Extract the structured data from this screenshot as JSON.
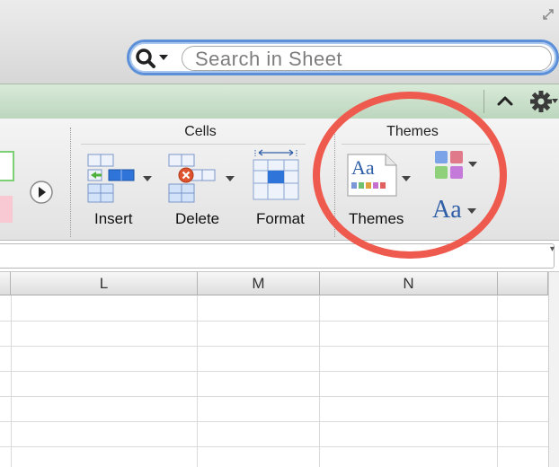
{
  "search": {
    "placeholder": "Search in Sheet"
  },
  "ribbon": {
    "cells_group": {
      "title": "Cells",
      "buttons": [
        {
          "label": "Insert"
        },
        {
          "label": "Delete"
        },
        {
          "label": "Format"
        }
      ]
    },
    "themes_group": {
      "title": "Themes",
      "buttons": [
        {
          "label": "Themes"
        }
      ]
    },
    "font_sample": "Aa",
    "theme_sample": "Aa"
  },
  "columns": [
    "L",
    "M",
    "N"
  ],
  "colors": {
    "highlight": "#ef5a4e",
    "tab_green": "#c7ddc8",
    "search_ring": "#5b8fd8"
  }
}
